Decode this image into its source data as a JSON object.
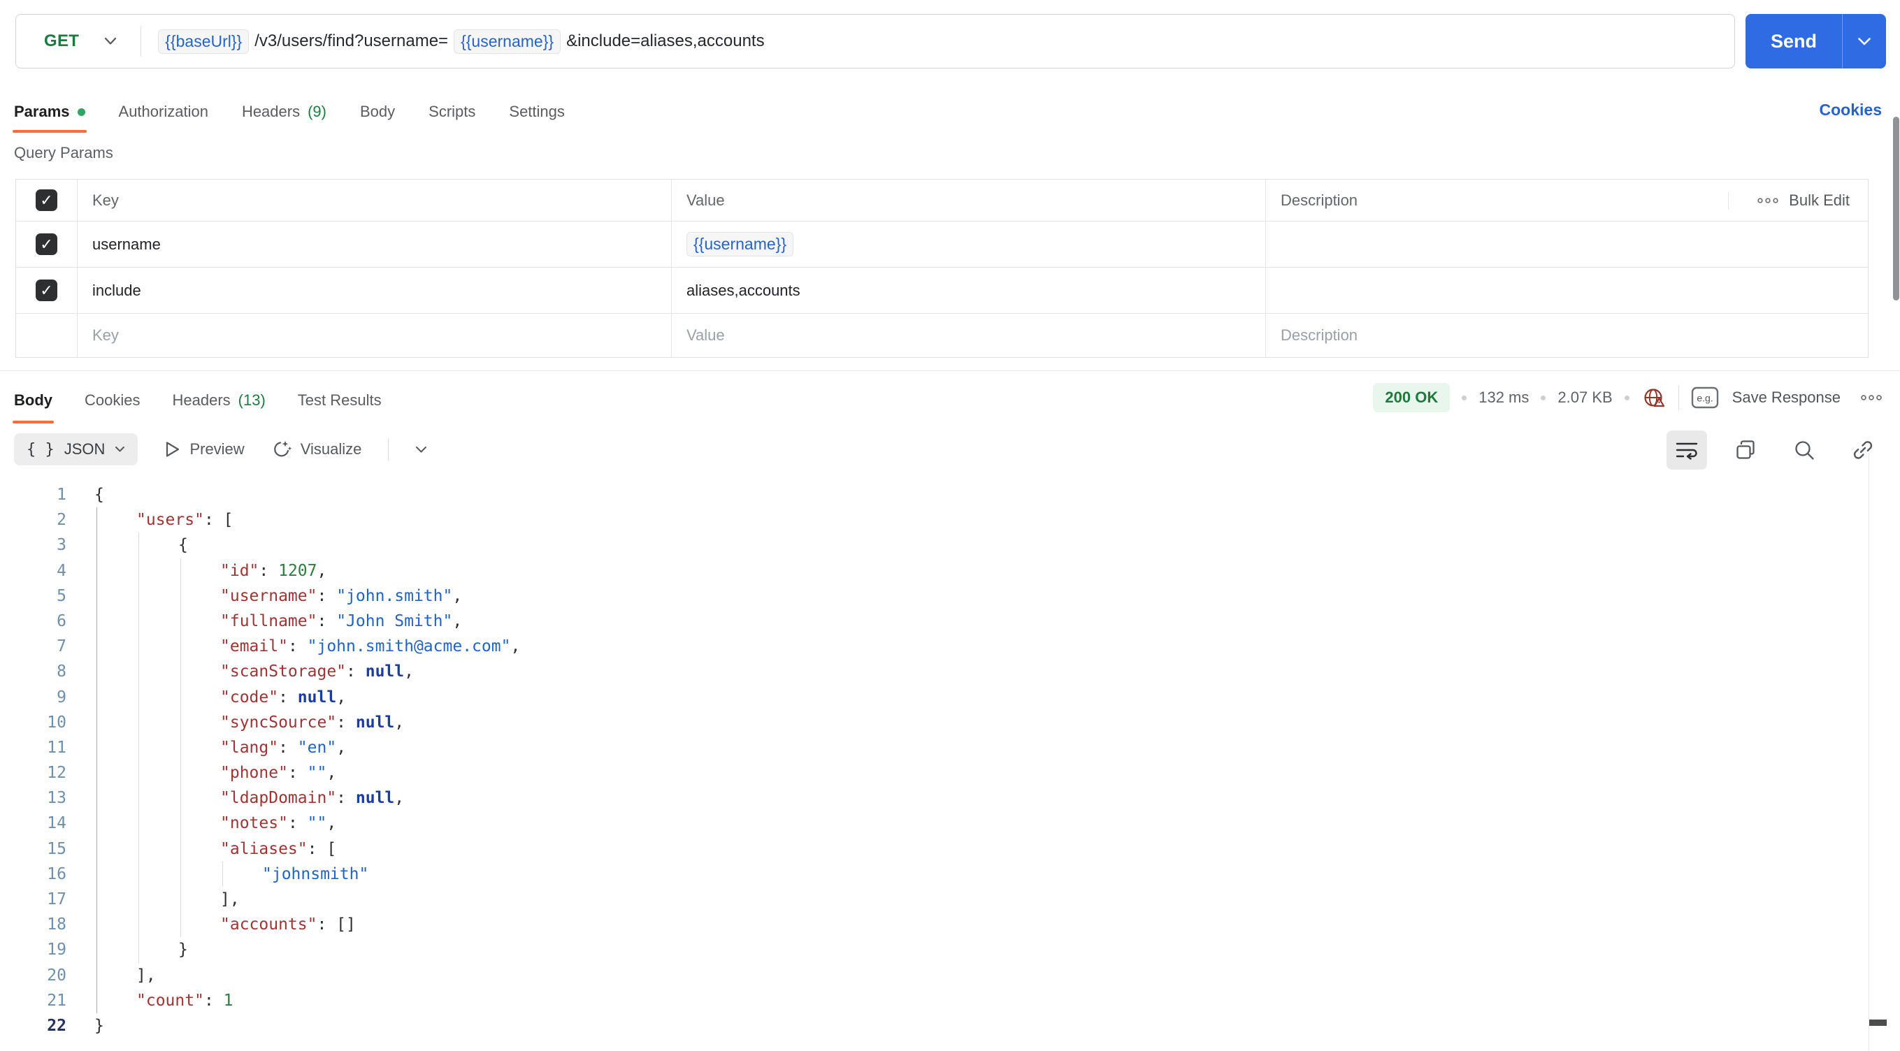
{
  "request": {
    "method": "GET",
    "send_label": "Send",
    "url_tokens": [
      {
        "type": "var",
        "text": "{{baseUrl}}"
      },
      {
        "type": "text",
        "text": "/v3/users/find?username="
      },
      {
        "type": "var",
        "text": "{{username}}"
      },
      {
        "type": "text",
        "text": "&include=aliases,accounts"
      }
    ]
  },
  "request_tabs": [
    {
      "label": "Params",
      "active": true,
      "dot": true
    },
    {
      "label": "Authorization"
    },
    {
      "label": "Headers",
      "count": "(9)"
    },
    {
      "label": "Body"
    },
    {
      "label": "Scripts"
    },
    {
      "label": "Settings"
    }
  ],
  "cookies_link": "Cookies",
  "query_params": {
    "title": "Query Params",
    "columns": [
      "Key",
      "Value",
      "Description"
    ],
    "bulk_edit_label": "Bulk Edit",
    "rows": [
      {
        "checked": true,
        "key": "username",
        "value": "{{username}}",
        "value_is_var": true,
        "description": ""
      },
      {
        "checked": true,
        "key": "include",
        "value": "aliases,accounts",
        "value_is_var": false,
        "description": ""
      }
    ],
    "placeholder_row": {
      "key": "Key",
      "value": "Value",
      "description": "Description"
    }
  },
  "response": {
    "tabs": [
      {
        "label": "Body",
        "active": true
      },
      {
        "label": "Cookies"
      },
      {
        "label": "Headers",
        "count": "(13)"
      },
      {
        "label": "Test Results"
      }
    ],
    "status": "200 OK",
    "time": "132 ms",
    "size": "2.07 KB",
    "save_label": "Save Response",
    "format_label": "JSON",
    "preview_label": "Preview",
    "visualize_label": "Visualize",
    "eg_badge": "e.g."
  },
  "code": {
    "active_line": 22,
    "lines": [
      {
        "num": 1,
        "indent": 0,
        "guides": [],
        "tokens": [
          [
            "p",
            "{"
          ]
        ]
      },
      {
        "num": 2,
        "indent": 1,
        "guides": [
          0
        ],
        "tokens": [
          [
            "k",
            "\"users\""
          ],
          [
            "p",
            ": ["
          ]
        ]
      },
      {
        "num": 3,
        "indent": 2,
        "guides": [
          0,
          1
        ],
        "tokens": [
          [
            "p",
            "{"
          ]
        ]
      },
      {
        "num": 4,
        "indent": 3,
        "guides": [
          0,
          1,
          2
        ],
        "tokens": [
          [
            "k",
            "\"id\""
          ],
          [
            "p",
            ": "
          ],
          [
            "n",
            "1207"
          ],
          [
            "p",
            ","
          ]
        ]
      },
      {
        "num": 5,
        "indent": 3,
        "guides": [
          0,
          1,
          2
        ],
        "tokens": [
          [
            "k",
            "\"username\""
          ],
          [
            "p",
            ": "
          ],
          [
            "s",
            "\"john.smith\""
          ],
          [
            "p",
            ","
          ]
        ]
      },
      {
        "num": 6,
        "indent": 3,
        "guides": [
          0,
          1,
          2
        ],
        "tokens": [
          [
            "k",
            "\"fullname\""
          ],
          [
            "p",
            ": "
          ],
          [
            "s",
            "\"John Smith\""
          ],
          [
            "p",
            ","
          ]
        ]
      },
      {
        "num": 7,
        "indent": 3,
        "guides": [
          0,
          1,
          2
        ],
        "tokens": [
          [
            "k",
            "\"email\""
          ],
          [
            "p",
            ": "
          ],
          [
            "s",
            "\"john.smith@acme.com\""
          ],
          [
            "p",
            ","
          ]
        ]
      },
      {
        "num": 8,
        "indent": 3,
        "guides": [
          0,
          1,
          2
        ],
        "tokens": [
          [
            "k",
            "\"scanStorage\""
          ],
          [
            "p",
            ": "
          ],
          [
            "b",
            "null"
          ],
          [
            "p",
            ","
          ]
        ]
      },
      {
        "num": 9,
        "indent": 3,
        "guides": [
          0,
          1,
          2
        ],
        "tokens": [
          [
            "k",
            "\"code\""
          ],
          [
            "p",
            ": "
          ],
          [
            "b",
            "null"
          ],
          [
            "p",
            ","
          ]
        ]
      },
      {
        "num": 10,
        "indent": 3,
        "guides": [
          0,
          1,
          2
        ],
        "tokens": [
          [
            "k",
            "\"syncSource\""
          ],
          [
            "p",
            ": "
          ],
          [
            "b",
            "null"
          ],
          [
            "p",
            ","
          ]
        ]
      },
      {
        "num": 11,
        "indent": 3,
        "guides": [
          0,
          1,
          2
        ],
        "tokens": [
          [
            "k",
            "\"lang\""
          ],
          [
            "p",
            ": "
          ],
          [
            "s",
            "\"en\""
          ],
          [
            "p",
            ","
          ]
        ]
      },
      {
        "num": 12,
        "indent": 3,
        "guides": [
          0,
          1,
          2
        ],
        "tokens": [
          [
            "k",
            "\"phone\""
          ],
          [
            "p",
            ": "
          ],
          [
            "s",
            "\"\""
          ],
          [
            "p",
            ","
          ]
        ]
      },
      {
        "num": 13,
        "indent": 3,
        "guides": [
          0,
          1,
          2
        ],
        "tokens": [
          [
            "k",
            "\"ldapDomain\""
          ],
          [
            "p",
            ": "
          ],
          [
            "b",
            "null"
          ],
          [
            "p",
            ","
          ]
        ]
      },
      {
        "num": 14,
        "indent": 3,
        "guides": [
          0,
          1,
          2
        ],
        "tokens": [
          [
            "k",
            "\"notes\""
          ],
          [
            "p",
            ": "
          ],
          [
            "s",
            "\"\""
          ],
          [
            "p",
            ","
          ]
        ]
      },
      {
        "num": 15,
        "indent": 3,
        "guides": [
          0,
          1,
          2
        ],
        "tokens": [
          [
            "k",
            "\"aliases\""
          ],
          [
            "p",
            ": ["
          ]
        ]
      },
      {
        "num": 16,
        "indent": 4,
        "guides": [
          0,
          1,
          2,
          3
        ],
        "tokens": [
          [
            "s",
            "\"johnsmith\""
          ]
        ]
      },
      {
        "num": 17,
        "indent": 3,
        "guides": [
          0,
          1,
          2
        ],
        "tokens": [
          [
            "p",
            "],"
          ]
        ]
      },
      {
        "num": 18,
        "indent": 3,
        "guides": [
          0,
          1,
          2
        ],
        "tokens": [
          [
            "k",
            "\"accounts\""
          ],
          [
            "p",
            ": []"
          ]
        ]
      },
      {
        "num": 19,
        "indent": 2,
        "guides": [
          0,
          1
        ],
        "tokens": [
          [
            "p",
            "}"
          ]
        ]
      },
      {
        "num": 20,
        "indent": 1,
        "guides": [
          0
        ],
        "tokens": [
          [
            "p",
            "],"
          ]
        ]
      },
      {
        "num": 21,
        "indent": 1,
        "guides": [
          0
        ],
        "tokens": [
          [
            "k",
            "\"count\""
          ],
          [
            "p",
            ": "
          ],
          [
            "n",
            "1"
          ]
        ]
      },
      {
        "num": 22,
        "indent": 0,
        "guides": [],
        "tokens": [
          [
            "p",
            "}"
          ]
        ]
      }
    ]
  },
  "colors": {
    "accent-orange": "#ff6c37",
    "method-green": "#177c3d",
    "send-blue": "#2f6ce3",
    "link-blue": "#2563c9",
    "count-green": "#1b7d41",
    "status-green": "#1c7c3c",
    "status-green-bg": "#e9f6ee",
    "error-red": "#93352a",
    "key-red": "#9e3434",
    "string-blue": "#2264c4",
    "number-green": "#2c7e3c",
    "null-navy": "#1c3da0",
    "line-number": "#6f8faa",
    "line-number-active": "#27335f"
  }
}
